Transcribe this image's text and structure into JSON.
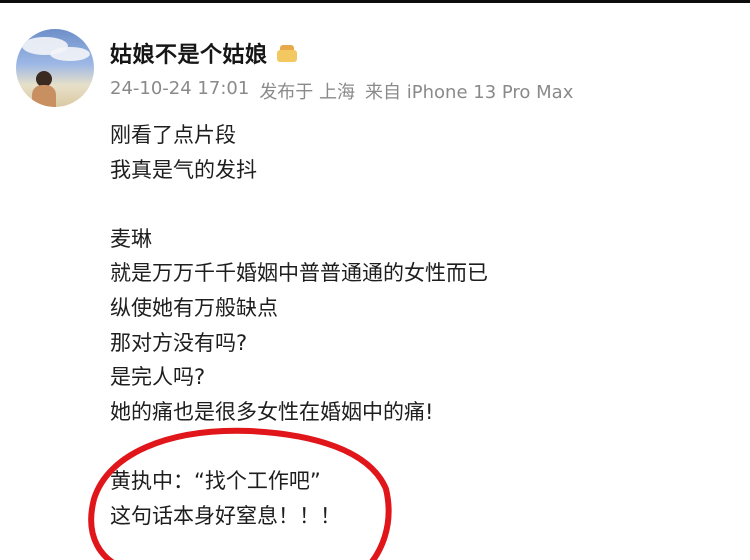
{
  "post": {
    "author": {
      "name": "姑娘不是个姑娘",
      "badge_icon": "gift-badge-icon"
    },
    "meta": {
      "datetime": "24-10-24 17:01",
      "location": "发布于 上海",
      "device": "来自 iPhone 13 Pro Max"
    },
    "content_lines": [
      "刚看了点片段",
      "我真是气的发抖",
      "",
      "麦琳",
      "就是万万千千婚姻中普普通通的女性而已",
      "纵使她有万般缺点",
      "那对方没有吗?",
      "是完人吗?",
      "她的痛也是很多女性在婚姻中的痛!",
      "",
      "黄执中：“找个工作吧”",
      "这句话本身好窒息！！！"
    ],
    "highlight_color": "#e0161b"
  }
}
